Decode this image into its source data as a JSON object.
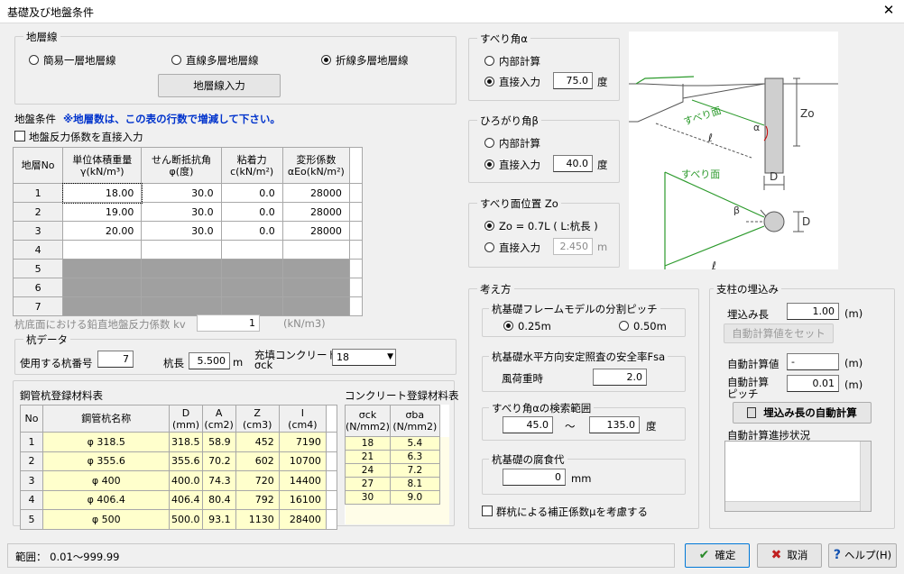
{
  "window": {
    "title": "基礎及び地盤条件",
    "close": "✕"
  },
  "layer_line": {
    "group_label": "地層線",
    "options": [
      "簡易一層地層線",
      "直線多層地層線",
      "折線多層地層線"
    ],
    "selected": 2,
    "input_button": "地層線入力"
  },
  "ground": {
    "label": "地盤条件",
    "note": "※地層数は、この表の行数で増減して下さい。",
    "direct_reaction_check": "地盤反力係数を直接入力",
    "headers": [
      [
        "地層No"
      ],
      [
        "単位体積重量",
        "γ(kN/m³)"
      ],
      [
        "せん断抵抗角",
        "φ(度)"
      ],
      [
        "粘着力",
        "c(kN/m²)"
      ],
      [
        "変形係数",
        "αEo(kN/m²)"
      ]
    ],
    "rows": [
      {
        "no": "1",
        "gamma": "18.00",
        "phi": "30.0",
        "c": "0.0",
        "eo": "28000"
      },
      {
        "no": "2",
        "gamma": "19.00",
        "phi": "30.0",
        "c": "0.0",
        "eo": "28000"
      },
      {
        "no": "3",
        "gamma": "20.00",
        "phi": "30.0",
        "c": "0.0",
        "eo": "28000"
      },
      {
        "no": "4",
        "gamma": "",
        "phi": "",
        "c": "",
        "eo": ""
      },
      {
        "no": "5",
        "gamma": "",
        "phi": "",
        "c": "",
        "eo": ""
      },
      {
        "no": "6",
        "gamma": "",
        "phi": "",
        "c": "",
        "eo": ""
      },
      {
        "no": "7",
        "gamma": "",
        "phi": "",
        "c": "",
        "eo": ""
      }
    ]
  },
  "kv": {
    "label": "杭底面における鉛直地盤反力係数 kv",
    "value": "1",
    "unit": "(kN/m3)"
  },
  "pile_data": {
    "group_label": "杭データ",
    "pile_no_label": "使用する杭番号",
    "pile_no": "7",
    "length_label": "杭長",
    "length": "5.500",
    "length_unit": "m",
    "concrete_label": "充填コンクリート",
    "concrete_sub": "σck",
    "concrete": "18"
  },
  "steel_table": {
    "label": "鋼管杭登録材料表",
    "headers": [
      [
        "No"
      ],
      [
        "鋼管杭名称"
      ],
      [
        "D",
        "(mm)"
      ],
      [
        "A",
        "(cm2)"
      ],
      [
        "Z",
        "(cm3)"
      ],
      [
        "I",
        "(cm4)"
      ]
    ],
    "rows": [
      {
        "no": "1",
        "name": "φ 318.5",
        "d": "318.5",
        "a": "58.9",
        "z": "452",
        "i": "7190"
      },
      {
        "no": "2",
        "name": "φ 355.6",
        "d": "355.6",
        "a": "70.2",
        "z": "602",
        "i": "10700"
      },
      {
        "no": "3",
        "name": "φ 400",
        "d": "400.0",
        "a": "74.3",
        "z": "720",
        "i": "14400"
      },
      {
        "no": "4",
        "name": "φ 406.4",
        "d": "406.4",
        "a": "80.4",
        "z": "792",
        "i": "16100"
      },
      {
        "no": "5",
        "name": "φ 500",
        "d": "500.0",
        "a": "93.1",
        "z": "1130",
        "i": "28400"
      }
    ]
  },
  "concrete_table": {
    "label": "コンクリート登録材料表",
    "headers": [
      [
        "σck",
        "(N/mm2)"
      ],
      [
        "σba",
        "(N/mm2)"
      ]
    ],
    "rows": [
      [
        "18",
        "5.4"
      ],
      [
        "21",
        "6.3"
      ],
      [
        "24",
        "7.2"
      ],
      [
        "27",
        "8.1"
      ],
      [
        "30",
        "9.0"
      ]
    ]
  },
  "slip_angle": {
    "group_label": "すべり角α",
    "opt1": "内部計算",
    "opt2": "直接入力",
    "value": "75.0",
    "unit": "度"
  },
  "spread_angle": {
    "group_label": "ひろがり角β",
    "opt1": "内部計算",
    "opt2": "直接入力",
    "value": "40.0",
    "unit": "度"
  },
  "slip_pos": {
    "group_label": "すべり面位置 Zo",
    "opt1": "Zo = 0.7L ( L:杭長 )",
    "opt2": "直接入力",
    "value": "2.450",
    "unit": "m"
  },
  "figure": {
    "slip1": "すべり面",
    "slip2": "すべり面",
    "zo": "Zo",
    "alpha": "α",
    "l": "ℓ",
    "d1": "D",
    "d2": "D",
    "beta": "β",
    "l2": "ℓ"
  },
  "thinking": {
    "group_label": "考え方",
    "pitch_label": "杭基礎フレームモデルの分割ピッチ",
    "pitch_opt1": "0.25m",
    "pitch_opt2": "0.50m",
    "fsa_label": "杭基礎水平方向安定照査の安全率Fsa",
    "fsa_sub": "風荷重時",
    "fsa_value": "2.0",
    "range_label": "すべり角αの検索範囲",
    "range_from": "45.0",
    "range_sep": "～",
    "range_to": "135.0",
    "range_unit": "度",
    "corr_label": "杭基礎の腐食代",
    "corr_value": "0",
    "corr_unit": "mm",
    "group_check": "群杭による補正係数μを考慮する"
  },
  "embed": {
    "group_label": "支柱の埋込み",
    "len_label": "埋込み長",
    "len_value": "1.00",
    "len_unit": "(m)",
    "set_button": "自動計算値をセット",
    "auto_label": "自動計算値",
    "auto_value": "-",
    "auto_unit": "(m)",
    "pitch_label1": "自動計算",
    "pitch_label2": "ピッチ",
    "pitch_value": "0.01",
    "pitch_unit": "(m)",
    "calc_button": "埋込み長の自動計算",
    "progress_label": "自動計算進捗状況"
  },
  "status": {
    "range": "範囲：  0.01～999.99"
  },
  "buttons": {
    "ok": "確定",
    "cancel": "取消",
    "help": "ヘルプ(H)"
  }
}
